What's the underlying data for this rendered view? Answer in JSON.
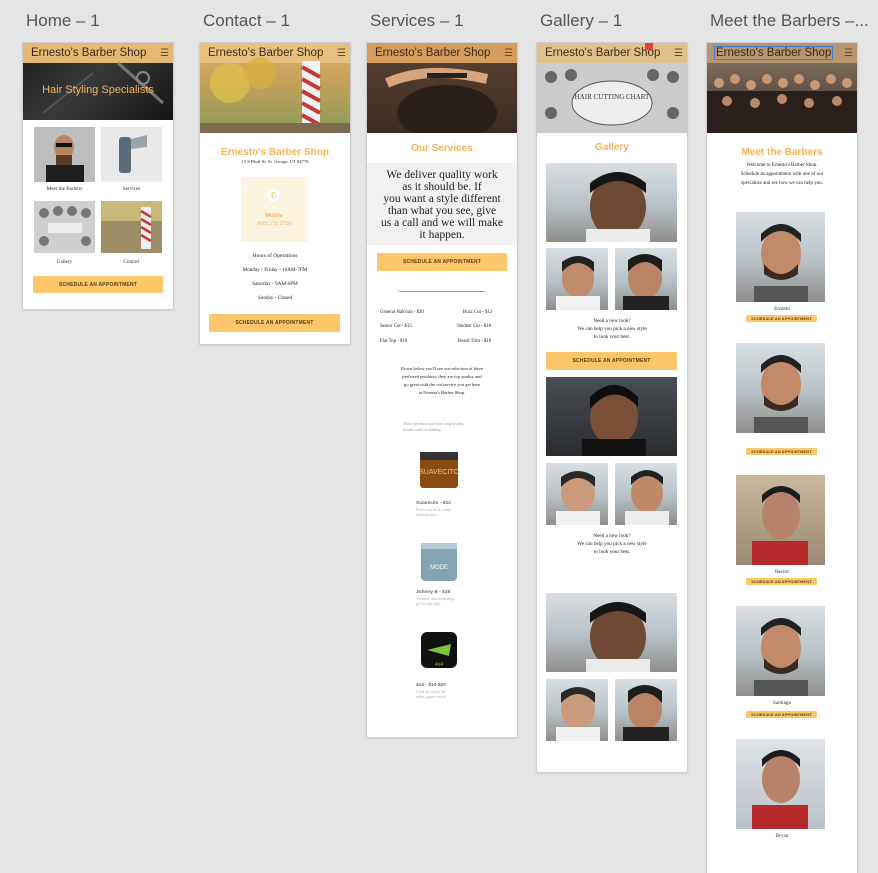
{
  "artboards": [
    {
      "title": "Home – 1"
    },
    {
      "title": "Contact – 1"
    },
    {
      "title": "Services – 1"
    },
    {
      "title": "Gallery – 1"
    },
    {
      "title": "Meet the Barbers –..."
    }
  ],
  "nav": {
    "brand": "Ernesto's Barber Shop",
    "menu_icon": "hamburger-menu-icon"
  },
  "home": {
    "hero_text": "Hair Styling Specialists",
    "tiles": [
      "Meet the Barbers",
      "Services",
      "Gallery",
      "Contact"
    ],
    "cta": "SCHEDULE AN APPOINTMENT"
  },
  "contact": {
    "heading": "Ernesto's Barber Shop",
    "address": "15 S Bluff St, St. George, UT 84770",
    "mobile_label": "Mobile",
    "mobile_number": "(435) 216-2719",
    "hours_title": "Hours of Operations",
    "hours": [
      "Monday - Friday - 10AM-7PM",
      "Saturday - 9AM-6PM",
      "Sunday - Closed"
    ],
    "cta": "SCHEDULE AN APPOINTMENT"
  },
  "services": {
    "heading": "Our Services",
    "intro": [
      "We deliver quality work",
      "as it should be. If",
      "you want a style different",
      "than what you see, give",
      "us a call and we will make",
      "it happen."
    ],
    "cta": "SCHEDULE AN APPOINTMENT",
    "prices_left": [
      "General Haircuts - $20",
      "Senior Cut - $15",
      "Flat Top - $18"
    ],
    "prices_right": [
      "Buzz Cut - $12",
      "Student Cut - $18",
      "Beard Trim - $10"
    ],
    "products_intro": [
      "Down below you'll see our selection of three",
      "preferred products, they are top quality and",
      "go great with the cut/service you get here",
      "at Ernesto's Barber Shop."
    ],
    "products_note": [
      "These products provide long-lasting",
      "results with no flaking."
    ],
    "products": [
      {
        "name": "Suavecito - $12",
        "desc": [
          "Perfect for thick, curly,",
          "stubborn hair."
        ],
        "label": "SUAVECITO"
      },
      {
        "name": "Johnny B - $15",
        "desc": [
          "Versatile, ultra-hydrating",
          "gel for fine hair."
        ],
        "label": "MODE"
      },
      {
        "name": "4x4 - $10-$20",
        "desc": [
          "Great for active life",
          "styles, gamer mood."
        ],
        "label": "4x4"
      }
    ]
  },
  "gallery": {
    "heading": "Gallery",
    "chart_banner": "HAIR CUTTING CHART",
    "need_look": [
      "Need a new look?",
      "We can help you pick a new style",
      "to look your best."
    ],
    "cta": "SCHEDULE AN APPOINTMENT"
  },
  "barbers": {
    "heading": "Meet the Barbers",
    "intro": [
      "Welcome to Ernesto's Barber Shop.",
      "Schedule an appointment with one of our",
      "specialists and see how we can help you."
    ],
    "members": [
      "Ernesto",
      "",
      "Hector",
      "Santiago",
      "Bryan"
    ],
    "cta": "SCHEDULE AN APPOINTMENT"
  },
  "colors": {
    "accent": "#fcc76a",
    "heading": "#f4b35c",
    "canvas": "#e5e5e5"
  }
}
